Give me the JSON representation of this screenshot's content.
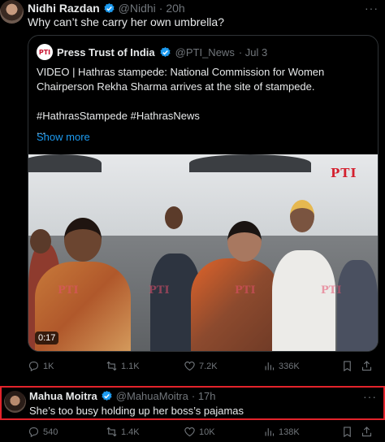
{
  "tweet1": {
    "name": "Nidhi Razdan",
    "handle": "@Nidhi",
    "time": "· 20h",
    "text": "Why can’t she carry her own umbrella?",
    "quote": {
      "logo": "PTI",
      "name": "Press Trust of India",
      "handle": "@PTI_News",
      "time": "· Jul 3",
      "text": "VIDEO | Hathras stampede: National Commission for Women Chairperson Rekha Sharma arrives at the site of stampede.\n\n#HathrasStampede #HathrasNews\n...",
      "show_more": "Show more",
      "video": {
        "watermark": "PTI",
        "duration": "0:17"
      }
    },
    "actions": {
      "replies": "1K",
      "reposts": "1.1K",
      "likes": "7.2K",
      "views": "336K"
    }
  },
  "tweet2": {
    "name": "Mahua Moitra",
    "handle": "@MahuaMoitra",
    "time": "· 17h",
    "text": "She’s too busy holding up her boss’s pajamas",
    "actions": {
      "replies": "540",
      "reposts": "1.4K",
      "likes": "10K",
      "views": "138K"
    }
  },
  "more_label": "···",
  "colors": {
    "accent": "#1d9bf0",
    "highlight_border": "#e3232b",
    "muted": "#71767b"
  }
}
